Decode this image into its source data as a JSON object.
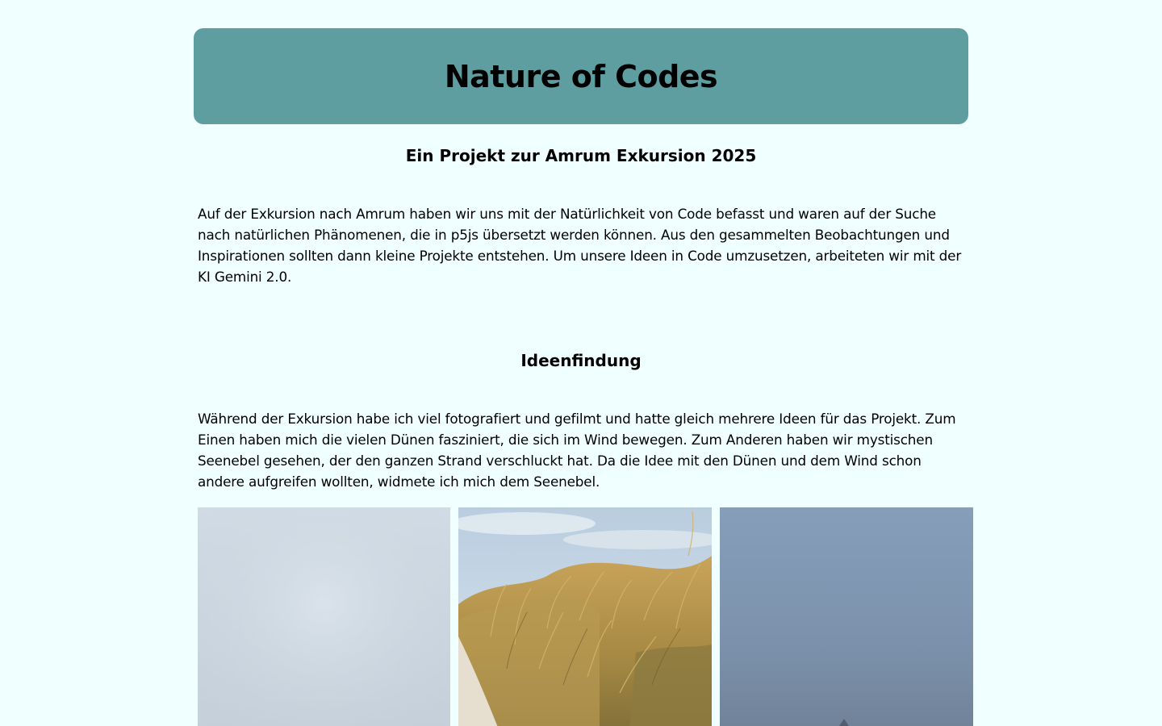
{
  "header": {
    "title": "Nature of Codes",
    "background_color": "#5f9ea0"
  },
  "page_background_color": "#f0ffff",
  "intro": {
    "subtitle": "Ein Projekt zur Amrum Exkursion 2025",
    "text": "Auf der Exkursion nach Amrum haben wir uns mit der Natürlichkeit von Code befasst und waren auf der Suche nach natürlichen Phänomenen, die in p5js übersetzt werden können. Aus den gesammelten Beobachtungen und Inspirationen sollten dann kleine Projekte entstehen. Um unsere Ideen in Code umzusetzen, arbeiteten wir mit der KI Gemini 2.0."
  },
  "ideation": {
    "title": "Ideenfindung",
    "text": "Während der Exkursion habe ich viel fotografiert und gefilmt und hatte gleich mehrere Ideen für das Projekt. Zum Einen haben mich die vielen Dünen fasziniert, die sich im Wind bewegen. Zum Anderen haben wir mystischen Seenebel gesehen, der den ganzen Strand verschluckt hat. Da die Idee mit den Dünen und dem Wind schon andere aufgreifen wollten, widmete ich mich dem Seenebel."
  },
  "gallery": {
    "images": [
      {
        "name": "foggy-sky-photo"
      },
      {
        "name": "dune-grass-photo"
      },
      {
        "name": "sea-fog-photo"
      }
    ]
  }
}
